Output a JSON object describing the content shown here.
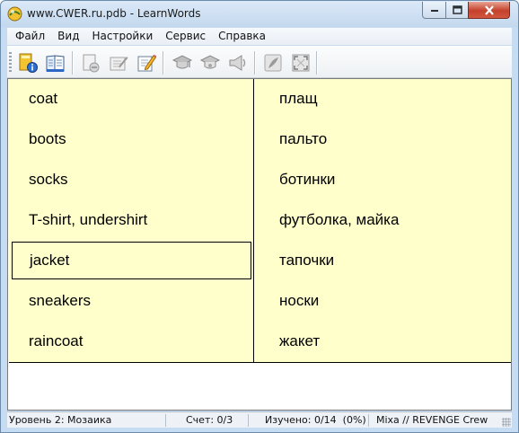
{
  "window": {
    "title": "www.CWER.ru.pdb - LearnWords"
  },
  "menu": [
    "Файл",
    "Вид",
    "Настройки",
    "Сервис",
    "Справка"
  ],
  "toolbar": {
    "buttons": [
      {
        "icon": "open-dictionary-icon"
      },
      {
        "icon": "dictionary-book-icon"
      },
      {
        "icon": "document-icon"
      },
      {
        "icon": "edit-note-icon"
      },
      {
        "icon": "edit-pencil-icon"
      },
      {
        "icon": "graduation-cap-icon"
      },
      {
        "icon": "graduation-cap-alt-icon"
      },
      {
        "icon": "speaker-icon"
      },
      {
        "icon": "feather-icon"
      },
      {
        "icon": "fullscreen-icon"
      }
    ]
  },
  "words": {
    "left": [
      "coat",
      "boots",
      "socks",
      "T-shirt, undershirt",
      "jacket",
      "sneakers",
      "raincoat"
    ],
    "right": [
      "плащ",
      "пальто",
      "ботинки",
      "футболка, майка",
      "тапочки",
      "носки",
      "жакет"
    ],
    "selected_left": "jacket"
  },
  "status": {
    "level": "Уровень 2: Мозаика",
    "score": "Счет: 0/3",
    "learned": "Изучено: 0/14  (0%)",
    "credits": "Mixa // REVENGE Crew"
  },
  "colors": {
    "panel_bg": "#ffffcc",
    "chrome_bg": "#c6dcf2",
    "close_button": "#c4412c"
  }
}
